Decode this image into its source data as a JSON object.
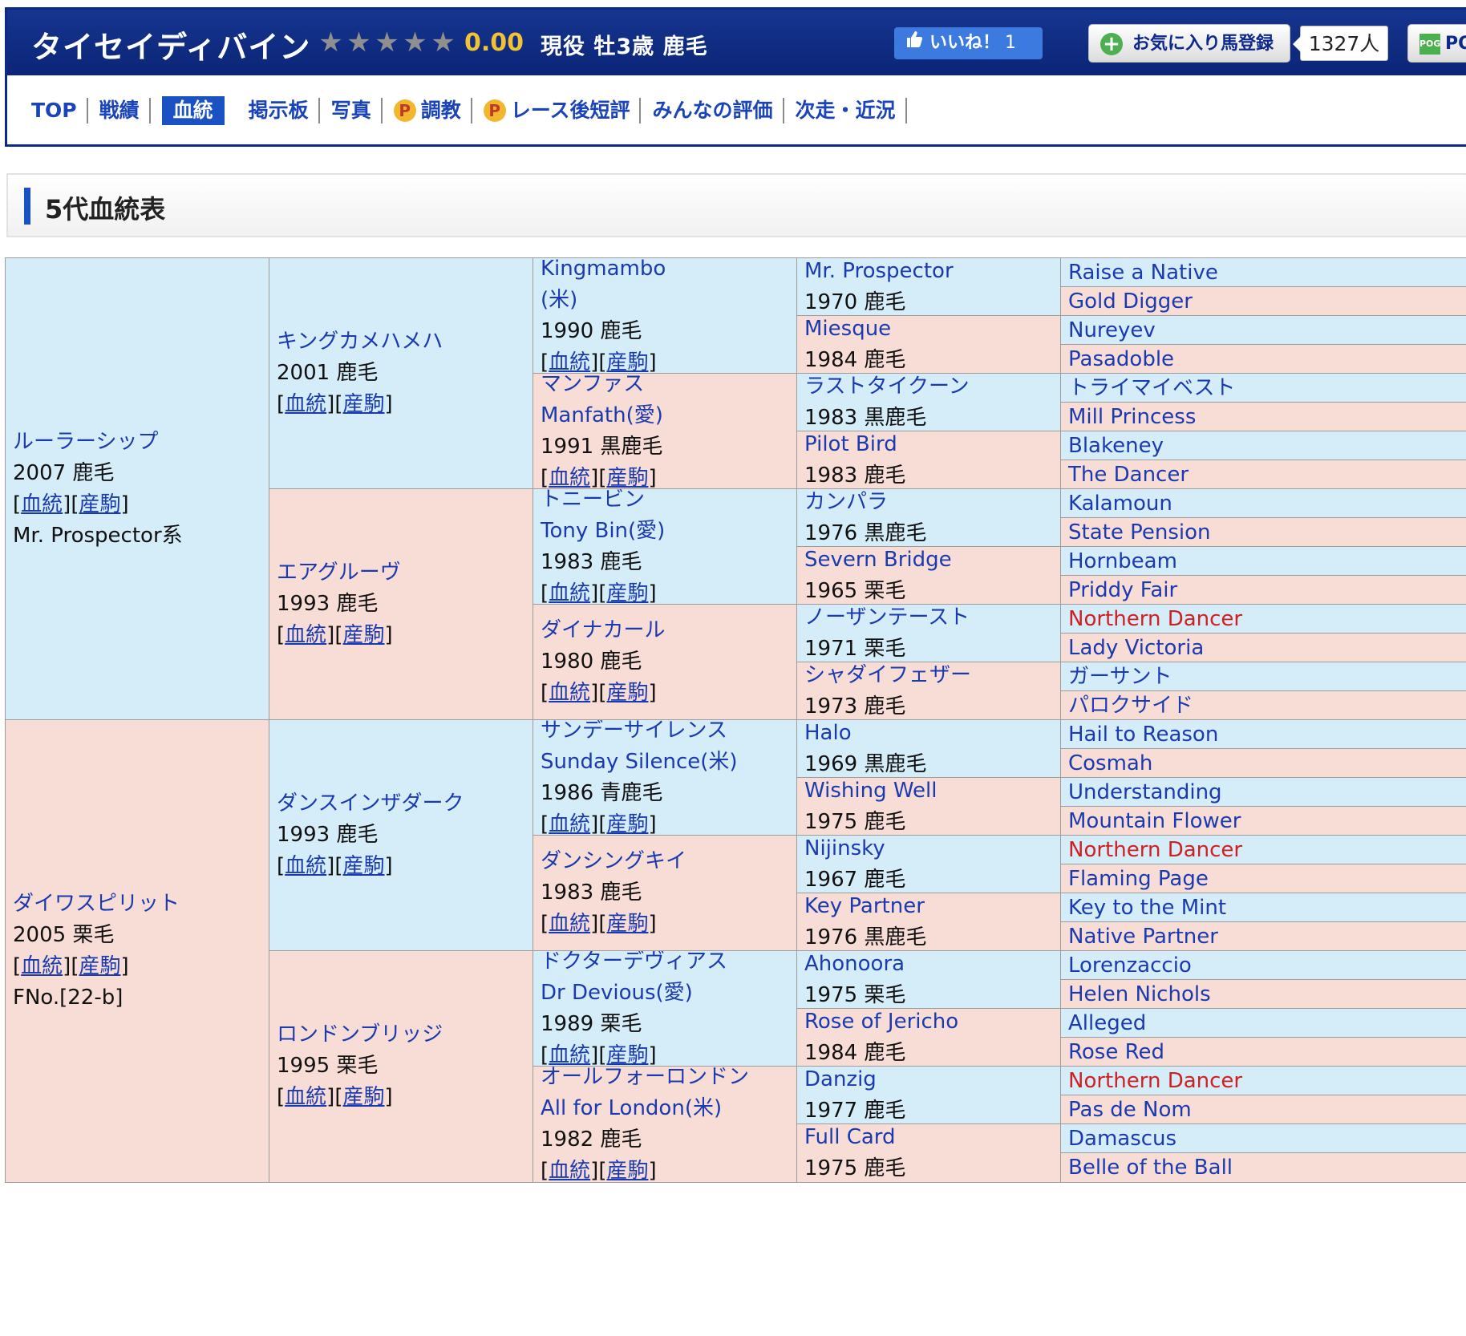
{
  "horse": {
    "name": "タイセイディバイン",
    "rating": "0.00",
    "status": "現役 牡3歳 鹿毛",
    "star_count": 5,
    "star_icon": "star-icon"
  },
  "buttons": {
    "like_label": "いいね！",
    "like_count": "1",
    "favorite_label": "お気に入り馬登録",
    "favorite_count": "1327人",
    "pog_label": "PO"
  },
  "tabs": [
    {
      "label": "TOP",
      "active": false,
      "premium": false
    },
    {
      "label": "戦績",
      "active": false,
      "premium": false
    },
    {
      "label": "血統",
      "active": true,
      "premium": false
    },
    {
      "label": "掲示板",
      "active": false,
      "premium": false
    },
    {
      "label": "写真",
      "active": false,
      "premium": false
    },
    {
      "label": "調教",
      "active": false,
      "premium": true
    },
    {
      "label": "レース後短評",
      "active": false,
      "premium": true
    },
    {
      "label": "みんなの評価",
      "active": false,
      "premium": false
    },
    {
      "label": "次走・近況",
      "active": false,
      "premium": false
    }
  ],
  "premium_icon_label": "P",
  "section_title": "5代血統表",
  "link_labels": {
    "bloodline": "血統",
    "offspring": "産駒"
  },
  "colors": {
    "male": "#d5ecf9",
    "female": "#f8dcd6",
    "link": "#1a3bb0",
    "highlight": "#d22020",
    "header": "#0d2a8a"
  },
  "pedigree": {
    "gen1": [
      {
        "name": "ルーラーシップ",
        "info": "2007 鹿毛",
        "links": true,
        "extra": "Mr. Prospector系",
        "sex": "m"
      },
      {
        "name": "ダイワスピリット",
        "info": "2005 栗毛",
        "links": true,
        "extra": "FNo.[22-b]",
        "sex": "f"
      }
    ],
    "gen2": [
      {
        "name": "キングカメハメハ",
        "info": "2001 鹿毛",
        "links": true,
        "sex": "m"
      },
      {
        "name": "エアグルーヴ",
        "info": "1993 鹿毛",
        "links": true,
        "sex": "f"
      },
      {
        "name": "ダンスインザダーク",
        "info": "1993 鹿毛",
        "links": true,
        "sex": "m"
      },
      {
        "name": "ロンドンブリッジ",
        "info": "1995 栗毛",
        "links": true,
        "sex": "f"
      }
    ],
    "gen3": [
      {
        "name": "Kingmambo",
        "name2": "(米)",
        "info": "1990 鹿毛",
        "links": true,
        "sex": "m"
      },
      {
        "name": "マンファス",
        "name2": "Manfath(愛)",
        "info": "1991 黒鹿毛",
        "links": true,
        "sex": "f"
      },
      {
        "name": "トニービン",
        "name2": "Tony Bin(愛)",
        "info": "1983 鹿毛",
        "links": true,
        "sex": "m"
      },
      {
        "name": "ダイナカール",
        "info": "1980 鹿毛",
        "links": true,
        "sex": "f"
      },
      {
        "name": "サンデーサイレンス",
        "name2": "Sunday Silence(米)",
        "info": "1986 青鹿毛",
        "links": true,
        "sex": "m"
      },
      {
        "name": "ダンシングキイ",
        "info": "1983 鹿毛",
        "links": true,
        "sex": "f"
      },
      {
        "name": "ドクターデヴィアス",
        "name2": "Dr Devious(愛)",
        "info": "1989 栗毛",
        "links": true,
        "sex": "m"
      },
      {
        "name": "オールフォーロンドン",
        "name2": "All for London(米)",
        "info": "1982 鹿毛",
        "links": true,
        "sex": "f"
      }
    ],
    "gen4": [
      {
        "name": "Mr. Prospector",
        "info": "1970 鹿毛",
        "sex": "m"
      },
      {
        "name": "Miesque",
        "info": "1984 鹿毛",
        "sex": "f"
      },
      {
        "name": "ラストタイクーン",
        "info": "1983 黒鹿毛",
        "sex": "m"
      },
      {
        "name": "Pilot Bird",
        "info": "1983 鹿毛",
        "sex": "f"
      },
      {
        "name": "カンパラ",
        "info": "1976 黒鹿毛",
        "sex": "m"
      },
      {
        "name": "Severn Bridge",
        "info": "1965 栗毛",
        "sex": "f"
      },
      {
        "name": "ノーザンテースト",
        "info": "1971 栗毛",
        "sex": "m"
      },
      {
        "name": "シャダイフェザー",
        "info": "1973 鹿毛",
        "sex": "f"
      },
      {
        "name": "Halo",
        "info": "1969 黒鹿毛",
        "sex": "m"
      },
      {
        "name": "Wishing Well",
        "info": "1975 鹿毛",
        "sex": "f"
      },
      {
        "name": "Nijinsky",
        "info": "1967 鹿毛",
        "sex": "m"
      },
      {
        "name": "Key Partner",
        "info": "1976 黒鹿毛",
        "sex": "f"
      },
      {
        "name": "Ahonoora",
        "info": "1975 栗毛",
        "sex": "m"
      },
      {
        "name": "Rose of Jericho",
        "info": "1984 鹿毛",
        "sex": "f"
      },
      {
        "name": "Danzig",
        "info": "1977 鹿毛",
        "sex": "m"
      },
      {
        "name": "Full Card",
        "info": "1975 鹿毛",
        "sex": "f"
      }
    ],
    "gen5": [
      {
        "name": "Raise a Native",
        "sex": "m"
      },
      {
        "name": "Gold Digger",
        "sex": "f"
      },
      {
        "name": "Nureyev",
        "sex": "m"
      },
      {
        "name": "Pasadoble",
        "sex": "f"
      },
      {
        "name": "トライマイベスト",
        "sex": "m"
      },
      {
        "name": "Mill Princess",
        "sex": "f"
      },
      {
        "name": "Blakeney",
        "sex": "m"
      },
      {
        "name": "The Dancer",
        "sex": "f"
      },
      {
        "name": "Kalamoun",
        "sex": "m"
      },
      {
        "name": "State Pension",
        "sex": "f"
      },
      {
        "name": "Hornbeam",
        "sex": "m"
      },
      {
        "name": "Priddy Fair",
        "sex": "f"
      },
      {
        "name": "Northern Dancer",
        "sex": "m",
        "highlight": true
      },
      {
        "name": "Lady Victoria",
        "sex": "f"
      },
      {
        "name": "ガーサント",
        "sex": "m"
      },
      {
        "name": "パロクサイド",
        "sex": "f"
      },
      {
        "name": "Hail to Reason",
        "sex": "m"
      },
      {
        "name": "Cosmah",
        "sex": "f"
      },
      {
        "name": "Understanding",
        "sex": "m"
      },
      {
        "name": "Mountain Flower",
        "sex": "f"
      },
      {
        "name": "Northern Dancer",
        "sex": "m",
        "highlight": true
      },
      {
        "name": "Flaming Page",
        "sex": "f"
      },
      {
        "name": "Key to the Mint",
        "sex": "m"
      },
      {
        "name": "Native Partner",
        "sex": "f"
      },
      {
        "name": "Lorenzaccio",
        "sex": "m"
      },
      {
        "name": "Helen Nichols",
        "sex": "f"
      },
      {
        "name": "Alleged",
        "sex": "m"
      },
      {
        "name": "Rose Red",
        "sex": "f"
      },
      {
        "name": "Northern Dancer",
        "sex": "m",
        "highlight": true
      },
      {
        "name": "Pas de Nom",
        "sex": "f"
      },
      {
        "name": "Damascus",
        "sex": "m"
      },
      {
        "name": "Belle of the Ball",
        "sex": "f"
      }
    ]
  }
}
